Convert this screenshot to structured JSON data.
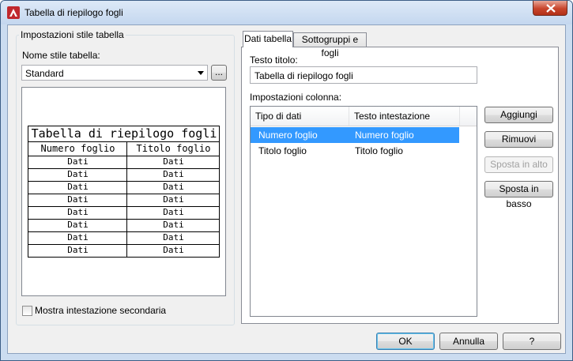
{
  "window": {
    "title": "Tabella di riepilogo fogli"
  },
  "left_group": {
    "caption": "Impostazioni stile tabella",
    "style_name_label": "Nome stile tabella:",
    "style_value": "Standard",
    "browse_label": "...",
    "preview": {
      "title": "Tabella di riepilogo fogli",
      "headers": [
        "Numero foglio",
        "Titolo foglio"
      ],
      "rows": [
        [
          "Dati",
          "Dati"
        ],
        [
          "Dati",
          "Dati"
        ],
        [
          "Dati",
          "Dati"
        ],
        [
          "Dati",
          "Dati"
        ],
        [
          "Dati",
          "Dati"
        ],
        [
          "Dati",
          "Dati"
        ],
        [
          "Dati",
          "Dati"
        ],
        [
          "Dati",
          "Dati"
        ]
      ]
    },
    "secondary_header_label": "Mostra intestazione secondaria",
    "secondary_header_checked": false
  },
  "tabs": [
    {
      "label": "Dati tabella",
      "active": true
    },
    {
      "label": "Sottogruppi e fogli",
      "active": false
    }
  ],
  "data_tab": {
    "title_text_label": "Testo titolo:",
    "title_text_value": "Tabella di riepilogo fogli",
    "columns_label": "Impostazioni colonna:",
    "columns_header": [
      "Tipo di dati",
      "Testo intestazione"
    ],
    "columns_rows": [
      {
        "type": "Numero foglio",
        "header": "Numero foglio",
        "selected": true
      },
      {
        "type": "Titolo foglio",
        "header": "Titolo foglio",
        "selected": false
      }
    ],
    "buttons": {
      "add": "Aggiungi",
      "remove": "Rimuovi",
      "move_up": "Sposta in alto",
      "move_down": "Sposta in basso"
    }
  },
  "footer": {
    "ok": "OK",
    "cancel": "Annulla",
    "help": "?"
  },
  "colors": {
    "selection": "#3399ff",
    "title_bar": "#c4d7ef",
    "close_button": "#c8452c"
  }
}
